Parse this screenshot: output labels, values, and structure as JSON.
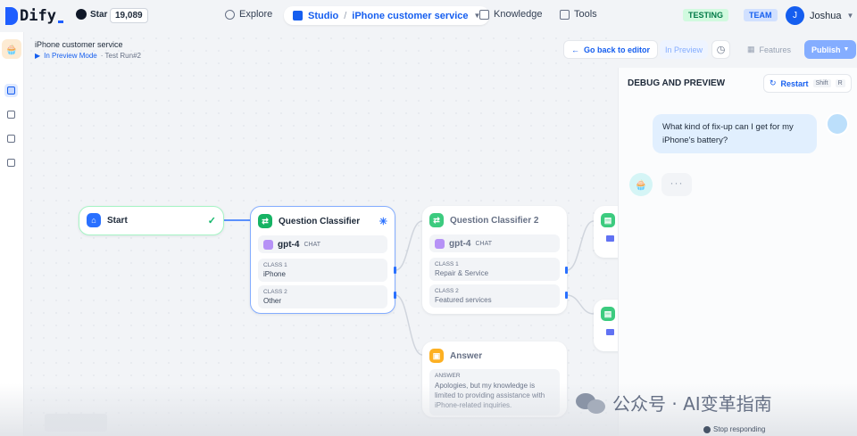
{
  "colors": {
    "accent": "#155eef",
    "publish": "#84adff",
    "testing_bg": "#d1fadf",
    "testing_fg": "#027a48",
    "start_check": "#12b76a"
  },
  "topnav": {
    "brand": "Dify",
    "github_label": "Star",
    "github_count": "19,089",
    "explore": "Explore",
    "studio": "Studio",
    "app_name": "iPhone customer service",
    "knowledge": "Knowledge",
    "tools": "Tools",
    "env_badge": "TESTING",
    "team_badge": "TEAM",
    "user_initial": "J",
    "user_name": "Joshua"
  },
  "breadcrumb": {
    "title": "iPhone customer service",
    "mode": "In Preview Mode",
    "run": "· Test Run#2"
  },
  "toolbar": {
    "back": "Go back to editor",
    "preview": "In Preview",
    "features": "Features",
    "publish": "Publish"
  },
  "nodes": {
    "start": {
      "title": "Start"
    },
    "qc1": {
      "title": "Question Classifier",
      "model": "gpt-4",
      "model_tag": "CHAT",
      "classes": [
        {
          "label": "CLASS 1",
          "value": "iPhone"
        },
        {
          "label": "CLASS 2",
          "value": "Other"
        }
      ]
    },
    "qc2": {
      "title": "Question Classifier 2",
      "model": "gpt-4",
      "model_tag": "CHAT",
      "classes": [
        {
          "label": "CLASS 1",
          "value": "Repair & Service"
        },
        {
          "label": "CLASS 2",
          "value": "Featured services"
        }
      ]
    },
    "answer": {
      "title": "Answer",
      "label": "ANSWER",
      "text": "Apologies, but my knowledge is limited to providing assistance with iPhone-related inquiries."
    }
  },
  "panel": {
    "title": "DEBUG AND PREVIEW",
    "restart": "Restart",
    "shortcut_1": "Shift",
    "shortcut_2": "R",
    "user_message": "What kind of fix-up can I get for my iPhone's battery?",
    "typing": "···",
    "stop": "Stop responding"
  },
  "watermark": "公众号 · AI变革指南"
}
